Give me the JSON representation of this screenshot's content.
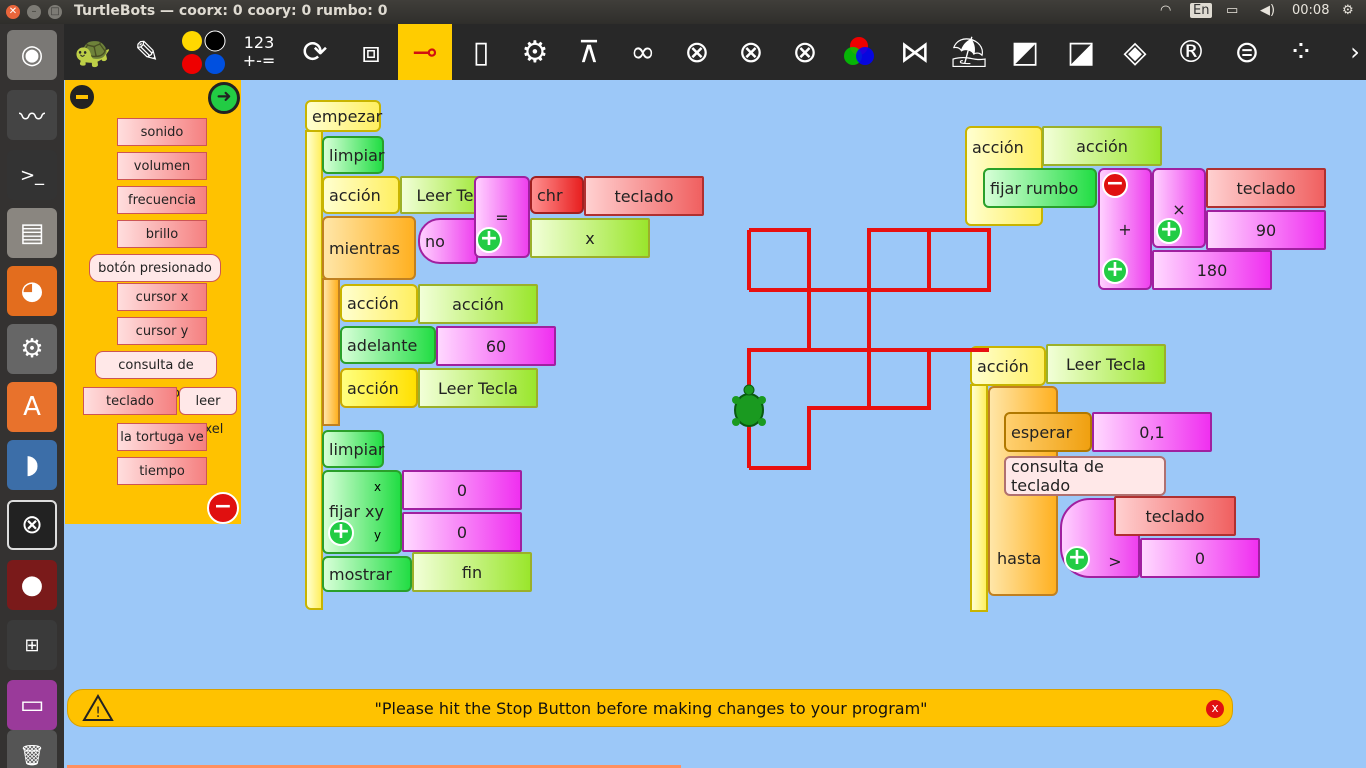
{
  "window": {
    "title": "TurtleBots — coorx: 0 coory: 0 rumbo: 0"
  },
  "tray": {
    "lang": "En",
    "time": "00:08"
  },
  "toolbar": {
    "number_label_top": "123",
    "number_label_bottom": "+-="
  },
  "palette": {
    "items": [
      "sonido",
      "volumen",
      "frecuencia",
      "brillo",
      "botón presionado",
      "cursor x",
      "cursor y",
      "consulta de teclado",
      "teclado",
      "leer pixel",
      "la tortuga ve",
      "tiempo"
    ]
  },
  "program_left": {
    "start": "empezar",
    "clear1": "limpiar",
    "action1": "acción",
    "action1_arg": "Leer Te",
    "while": "mientras",
    "not": "no",
    "eq": "=",
    "chr": "chr",
    "keyboard": "teclado",
    "x": "x",
    "action2": "acción",
    "action2_arg": "acción",
    "forward": "adelante",
    "forward_val": "60",
    "action3": "acción",
    "action3_arg": "Leer Tecla",
    "clear2": "limpiar",
    "setxy": "fijar xy",
    "setxy_x_label": "x",
    "setxy_y_label": "y",
    "setxy_x": "0",
    "setxy_y": "0",
    "show": "mostrar",
    "show_arg": "fin"
  },
  "program_right_top": {
    "action": "acción",
    "action_arg": "acción",
    "set_heading": "fijar rumbo",
    "keyboard": "teclado",
    "times": "×",
    "plus": "+",
    "ninety": "90",
    "one_eighty": "180"
  },
  "program_right_bottom": {
    "action": "acción",
    "action_arg": "Leer Tecla",
    "wait": "esperar",
    "wait_val": "0,1",
    "kbd_query": "consulta de teclado",
    "until": "hasta",
    "keyboard": "teclado",
    "gt": ">",
    "zero": "0"
  },
  "notice": {
    "text": "\"Please hit the Stop Button before making changes to your program\"",
    "close": "x"
  },
  "colors": {
    "palette_bg": "#ffc200",
    "canvas_bg": "#9cc8f8",
    "active_tool": "#ffcc00",
    "pen": "#e81010"
  }
}
